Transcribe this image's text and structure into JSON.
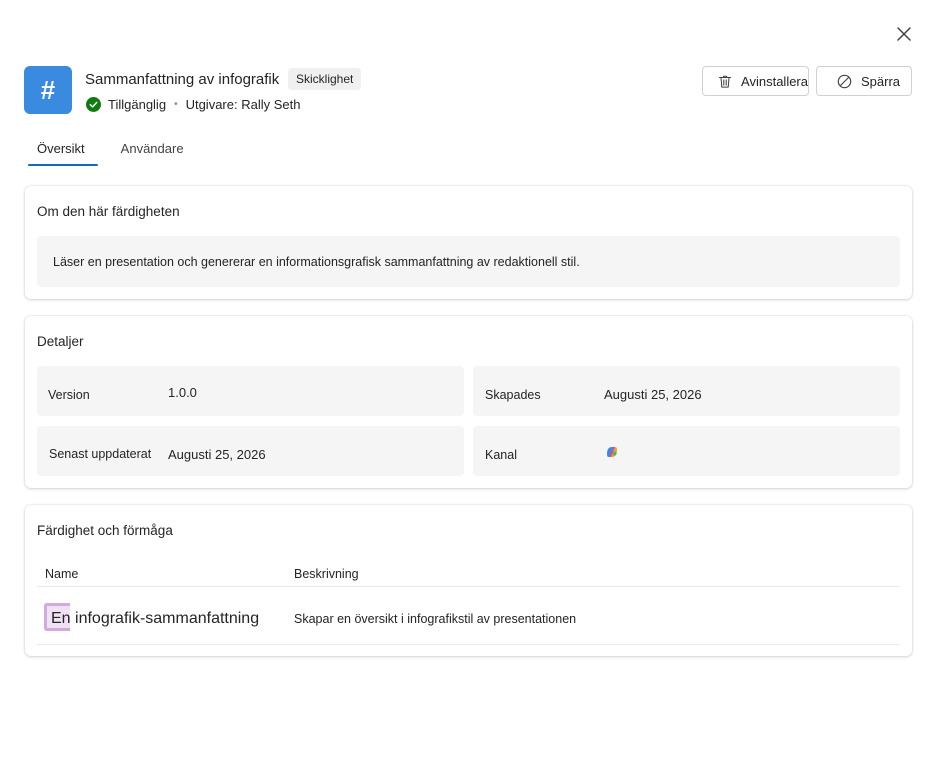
{
  "header": {
    "title": "Sammanfattning av infografik",
    "badge": "Skicklighet",
    "status": "Tillgänglig",
    "publisher": "Utgivare: Rally Seth",
    "icon_glyph": "#",
    "icon_color": "#3a8bdf"
  },
  "actions": {
    "uninstall_label": "Avinstallera",
    "block_label": "Spärra"
  },
  "tabs": [
    {
      "label": "Översikt",
      "active": true
    },
    {
      "label": "Användare",
      "active": false
    }
  ],
  "about": {
    "title": "Om den här färdigheten",
    "description": "Läser en presentation och genererar en informationsgrafisk sammanfattning av redaktionell stil."
  },
  "details": {
    "title": "Detaljer",
    "version_label": "Version",
    "version_value": "1.0.0",
    "created_label": "Skapades",
    "created_value": "Augusti 25, 2026",
    "updated_label": "Senast uppdaterat",
    "updated_value": "Augusti 25, 2026",
    "channel_label": "Kanal",
    "channel_icon": "copilot-icon"
  },
  "skills": {
    "title": "Färdighet och förmåga",
    "col_name": "Name",
    "col_desc": "Beskrivning",
    "rows": [
      {
        "name": "En infografik-sammanfattning",
        "description": "Skapar en översikt i infografikstil av presentationen"
      }
    ]
  },
  "colors": {
    "accent": "#0f6cbd",
    "status_ok": "#107c10"
  }
}
